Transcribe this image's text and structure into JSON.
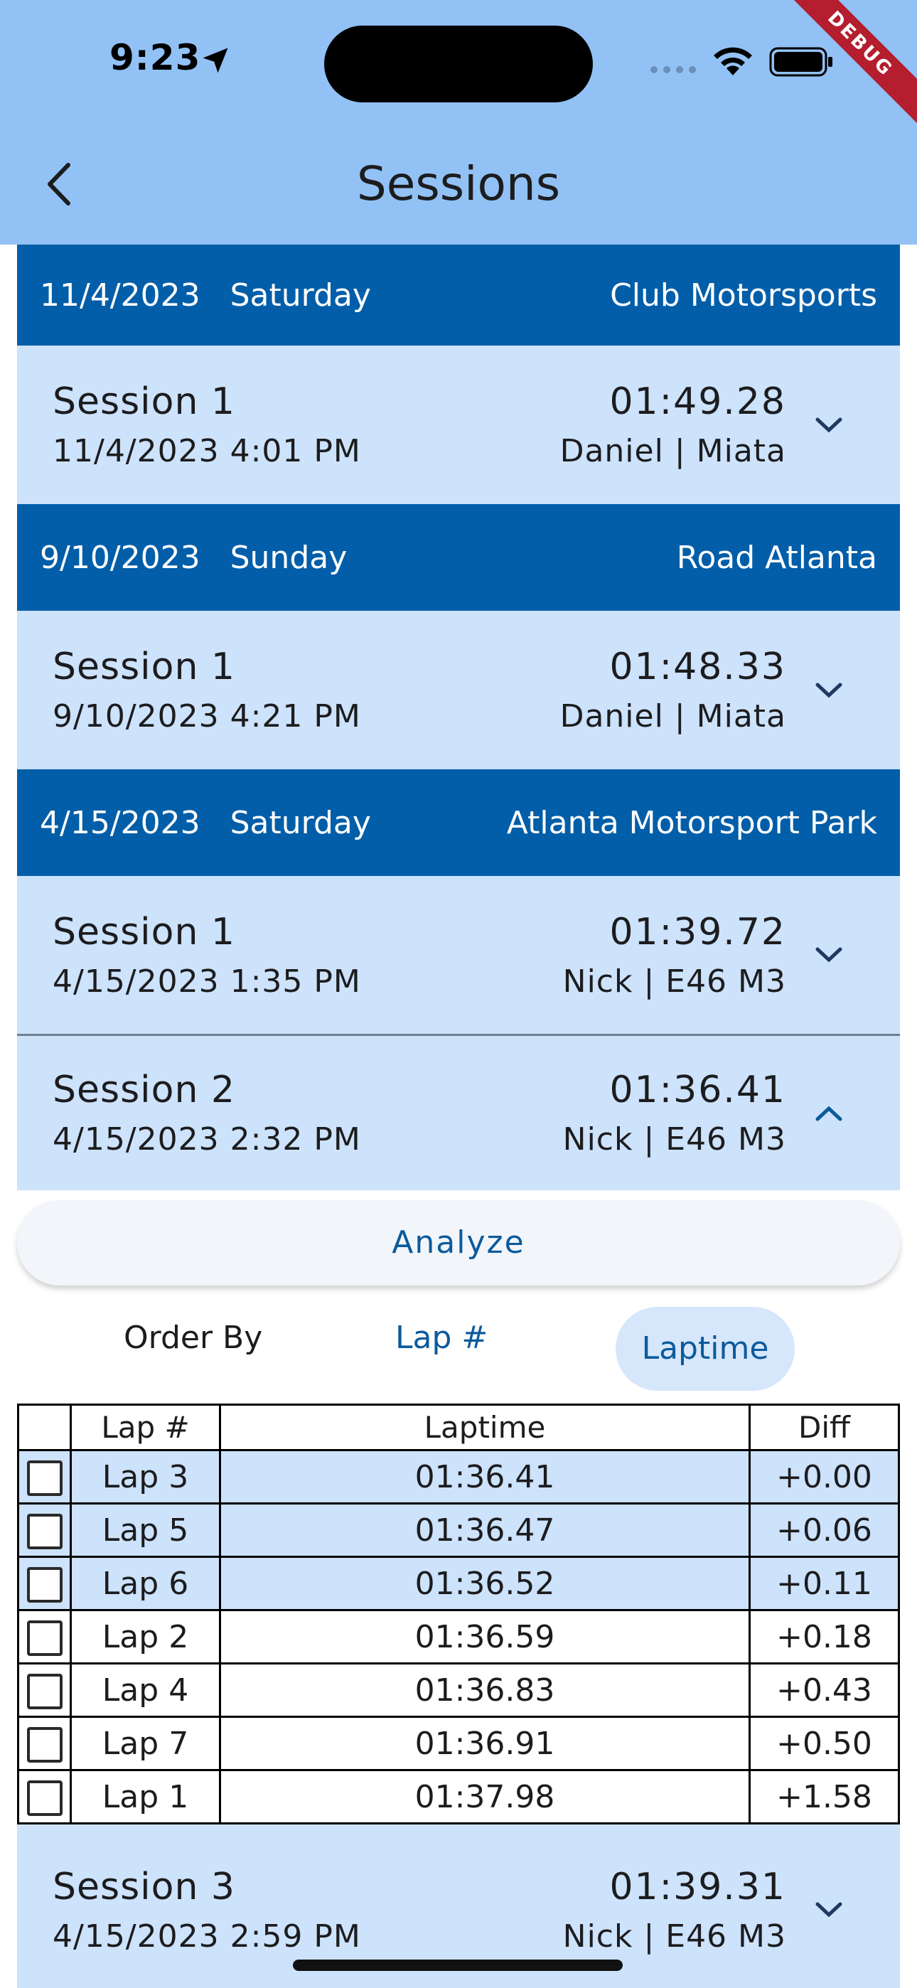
{
  "status": {
    "time": "9:23"
  },
  "debug_banner": "DEBUG",
  "header": {
    "title": "Sessions"
  },
  "days": [
    {
      "date": "11/4/2023",
      "weekday": "Saturday",
      "track": "Club Motorsports",
      "sessions": [
        {
          "name": "Session 1",
          "datetime": "11/4/2023 4:01 PM",
          "best": "01:49.28",
          "driver": "Daniel | Miata",
          "expanded": false
        }
      ]
    },
    {
      "date": "9/10/2023",
      "weekday": "Sunday",
      "track": "Road Atlanta",
      "sessions": [
        {
          "name": "Session 1",
          "datetime": "9/10/2023 4:21 PM",
          "best": "01:48.33",
          "driver": "Daniel | Miata",
          "expanded": false
        }
      ]
    },
    {
      "date": "4/15/2023",
      "weekday": "Saturday",
      "track": "Atlanta Motorsport Park",
      "sessions": [
        {
          "name": "Session 1",
          "datetime": "4/15/2023 1:35 PM",
          "best": "01:39.72",
          "driver": "Nick | E46 M3",
          "expanded": false
        },
        {
          "name": "Session 2",
          "datetime": "4/15/2023 2:32 PM",
          "best": "01:36.41",
          "driver": "Nick | E46 M3",
          "expanded": true
        },
        {
          "name": "Session 3",
          "datetime": "4/15/2023 2:59 PM",
          "best": "01:39.31",
          "driver": "Nick | E46 M3",
          "expanded": false
        }
      ]
    }
  ],
  "expanded": {
    "analyze_label": "Analyze",
    "order_by": {
      "label": "Order By",
      "options": [
        "Lap #",
        "Laptime"
      ],
      "selected": "Laptime"
    },
    "table": {
      "headers": [
        "",
        "Lap #",
        "Laptime",
        "Diff"
      ],
      "rows": [
        {
          "lap": "Lap 3",
          "time": "01:36.41",
          "diff": "+0.00",
          "highlight": true
        },
        {
          "lap": "Lap 5",
          "time": "01:36.47",
          "diff": "+0.06",
          "highlight": true
        },
        {
          "lap": "Lap 6",
          "time": "01:36.52",
          "diff": "+0.11",
          "highlight": true
        },
        {
          "lap": "Lap 2",
          "time": "01:36.59",
          "diff": "+0.18",
          "highlight": false
        },
        {
          "lap": "Lap 4",
          "time": "01:36.83",
          "diff": "+0.43",
          "highlight": false
        },
        {
          "lap": "Lap 7",
          "time": "01:36.91",
          "diff": "+0.50",
          "highlight": false
        },
        {
          "lap": "Lap 1",
          "time": "01:37.98",
          "diff": "+1.58",
          "highlight": false
        }
      ]
    }
  },
  "colors": {
    "appbar": "#92c1f5",
    "day_header": "#025ea8",
    "session_bg": "#cde2fb",
    "accent": "#0b5a9c"
  },
  "icons": {
    "back": "chevron-left-icon",
    "expand": "chevron-down-icon",
    "collapse": "chevron-up-icon",
    "location": "location-arrow-icon",
    "wifi": "wifi-icon",
    "battery": "battery-icon"
  }
}
